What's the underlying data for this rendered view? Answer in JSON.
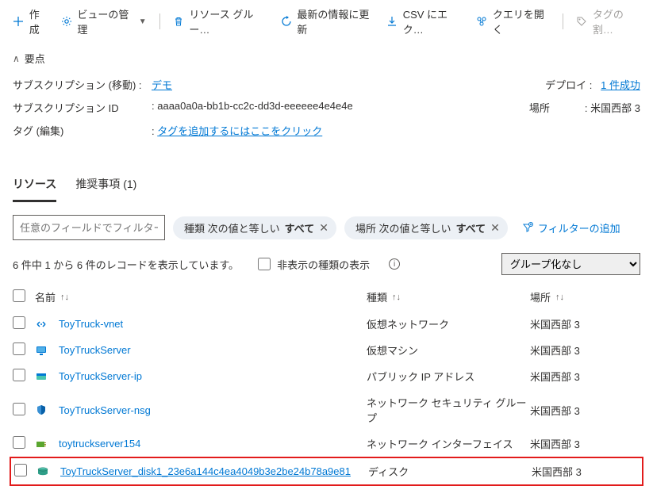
{
  "toolbar": {
    "create": "作成",
    "manage_view": "ビューの管理",
    "delete": "リソース グルー…",
    "refresh": "最新の情報に更新",
    "export_csv": "CSV にエク…",
    "open_query": "クエリを開く",
    "assign_tags": "タグの割…"
  },
  "essentials": {
    "header": "要点",
    "subscription_move_label": "サブスクリプション (移動) :",
    "subscription_link": "デモ",
    "subscription_id_label": "サブスクリプション ID",
    "subscription_id": "aaaa0a0a-bb1b-cc2c-dd3d-eeeeee4e4e4e",
    "tags_label": "タグ (編集)",
    "tags_placeholder": "タグを追加するにはここをクリック",
    "deploy_label": "デプロイ :",
    "deploy_value": "1 件成功",
    "location_label": "場所",
    "location_value": "米国西部 3"
  },
  "tabs": {
    "resources": "リソース",
    "recommendations": "推奨事項 (1)"
  },
  "filters": {
    "placeholder": "任意のフィールドでフィルター...",
    "type_label": "種類 次の値と等しい",
    "type_value": "すべて",
    "location_label": "場所 次の値と等しい",
    "location_value": "すべて",
    "add_filter": "フィルターの追加"
  },
  "status": {
    "count_text": "6 件中 1 から 6 件のレコードを表示しています。",
    "show_hidden": "非表示の種類の表示",
    "grouping_none": "グループ化なし"
  },
  "columns": {
    "name": "名前",
    "type": "種類",
    "location": "場所"
  },
  "rows": [
    {
      "name": "ToyTruck-vnet",
      "type": "仮想ネットワーク",
      "location": "米国西部 3",
      "icon": "vnet"
    },
    {
      "name": "ToyTruckServer",
      "type": "仮想マシン",
      "location": "米国西部 3",
      "icon": "vm"
    },
    {
      "name": "ToyTruckServer-ip",
      "type": "パブリック IP アドレス",
      "location": "米国西部 3",
      "icon": "ip"
    },
    {
      "name": "ToyTruckServer-nsg",
      "type": "ネットワーク セキュリティ グループ",
      "location": "米国西部 3",
      "icon": "nsg"
    },
    {
      "name": "toytruckserver154",
      "type": "ネットワーク インターフェイス",
      "location": "米国西部 3",
      "icon": "nic"
    },
    {
      "name": "ToyTruckServer_disk1_23e6a144c4ea4049b3e2be24b78a9e81",
      "type": "ディスク",
      "location": "米国西部 3",
      "icon": "disk",
      "highlight": true
    }
  ],
  "sort_glyph": "↑↓"
}
